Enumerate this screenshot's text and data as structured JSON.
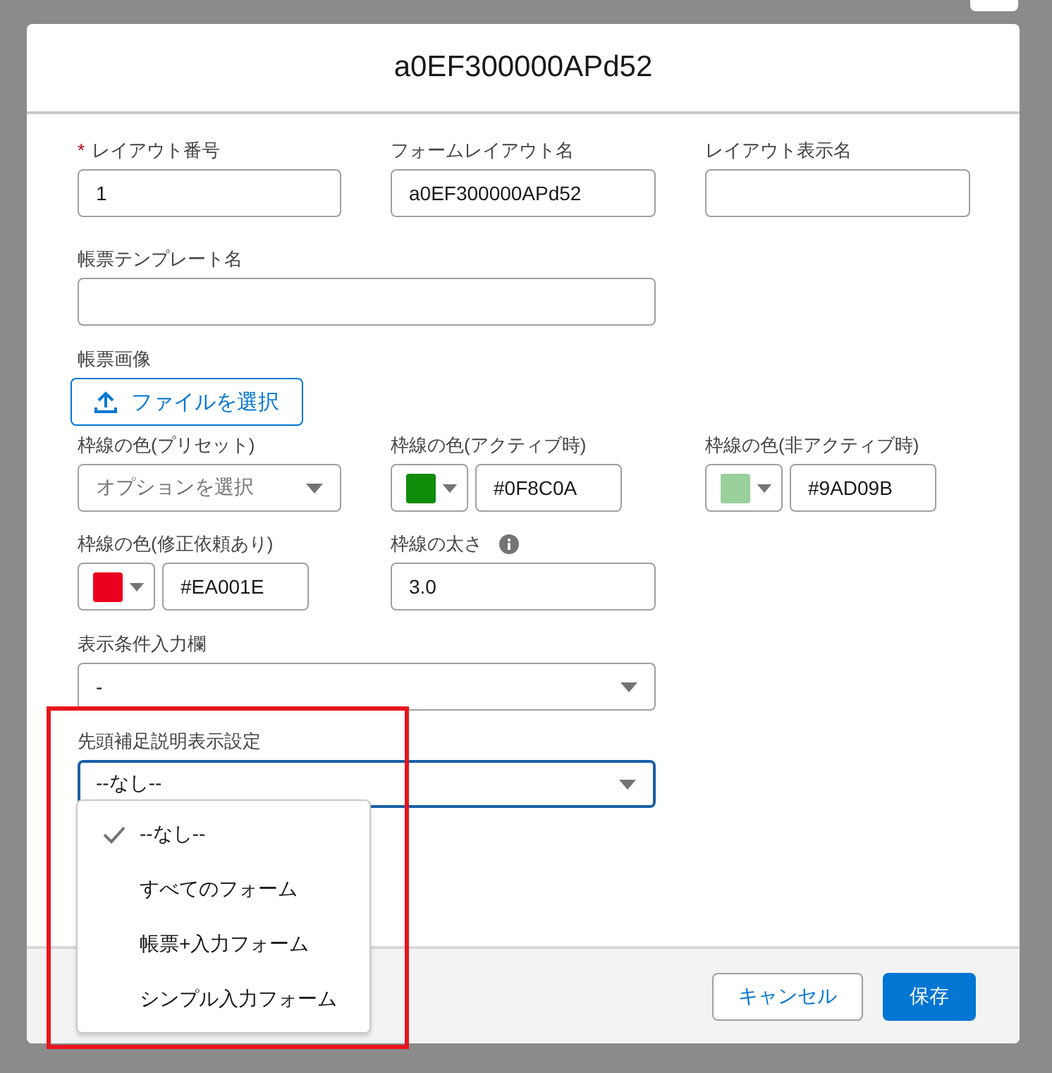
{
  "modal": {
    "title": "a0EF300000APd52"
  },
  "rows": [
    {
      "fields": [
        {
          "kind": "text",
          "required_mark": "*",
          "label": "レイアウト番号",
          "value": "1"
        },
        {
          "kind": "text",
          "label": "フォームレイアウト名",
          "value": "a0EF300000APd52"
        },
        {
          "kind": "text",
          "label": "レイアウト表示名"
        }
      ]
    },
    {
      "fields": [
        {
          "kind": "text",
          "label": "帳票テンプレート名"
        }
      ]
    },
    {
      "fields": [
        {
          "kind": "file",
          "label": "帳票画像",
          "button": "ファイルを選択"
        }
      ]
    },
    {
      "fields": [
        {
          "kind": "select",
          "label": "枠線の色(プリセット)",
          "placeholder": "オプションを選択",
          "focused": false
        },
        {
          "kind": "color",
          "label": "枠線の色(アクティブ時)",
          "color": "#0f8c0a",
          "value": "#0F8C0A"
        },
        {
          "kind": "color",
          "label": "枠線の色(非アクティブ時)",
          "color": "#9ad09b",
          "value": "#9AD09B"
        }
      ]
    },
    {
      "fields": [
        {
          "kind": "color",
          "label": "枠線の色(修正依頼あり)",
          "color": "#ea001e",
          "value": "#EA001E"
        },
        {
          "kind": "text",
          "label": "枠線の太さ",
          "info": true,
          "value": "3.0"
        }
      ]
    },
    {
      "fields": [
        {
          "kind": "select",
          "label": "表示条件入力欄",
          "value": "-",
          "focused": false
        }
      ]
    },
    {
      "fields": [
        {
          "kind": "select",
          "label": "先頭補足説明表示設定",
          "value": "--なし--",
          "focused": true,
          "expanded": true,
          "highlighted": true,
          "options": [
            {
              "label": "--なし--",
              "selected": true
            },
            {
              "label": "すべてのフォーム",
              "selected": false
            },
            {
              "label": "帳票+入力フォーム",
              "selected": false
            },
            {
              "label": "シンプル入力フォーム",
              "selected": false
            }
          ]
        }
      ]
    }
  ],
  "footer": {
    "buttons": [
      {
        "label": "キャンセル",
        "kind": "neutral"
      },
      {
        "label": "保存",
        "kind": "brand"
      }
    ]
  }
}
